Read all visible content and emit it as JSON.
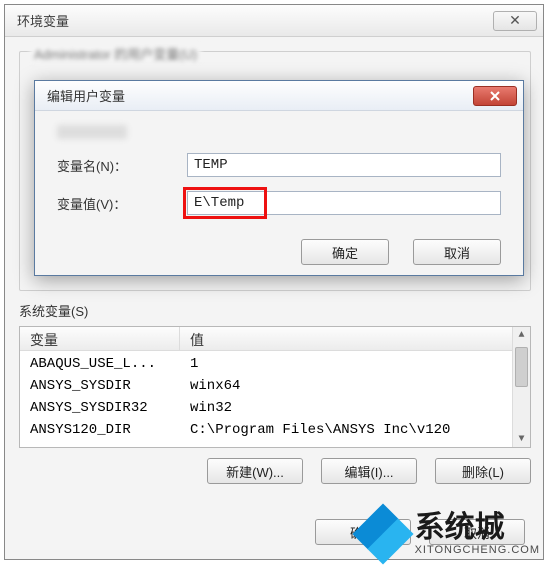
{
  "outer": {
    "title": "环境变量",
    "close_glyph": "✕",
    "user_group_label": "Administrator 的用户变量(U)",
    "sys_label": "系统变量(S)",
    "col_name": "变量",
    "col_value": "值",
    "rows": [
      {
        "name": "ABAQUS_USE_L...",
        "value": "1"
      },
      {
        "name": "ANSYS_SYSDIR",
        "value": "winx64"
      },
      {
        "name": "ANSYS_SYSDIR32",
        "value": "win32"
      },
      {
        "name": "ANSYS120_DIR",
        "value": "C:\\Program Files\\ANSYS Inc\\v120"
      }
    ],
    "btn_new": "新建(W)...",
    "btn_edit": "编辑(I)...",
    "btn_del": "删除(L)",
    "btn_ok": "确定",
    "btn_cancel": "取消"
  },
  "modal": {
    "title": "编辑用户变量",
    "name_label": "变量名(N)：",
    "value_label": "变量值(V)：",
    "name_value": "TEMP",
    "value_value": "E\\Temp",
    "btn_ok": "确定",
    "btn_cancel": "取消"
  },
  "watermark": {
    "cn": "系统城",
    "en": "XITONGCHENG.COM"
  }
}
